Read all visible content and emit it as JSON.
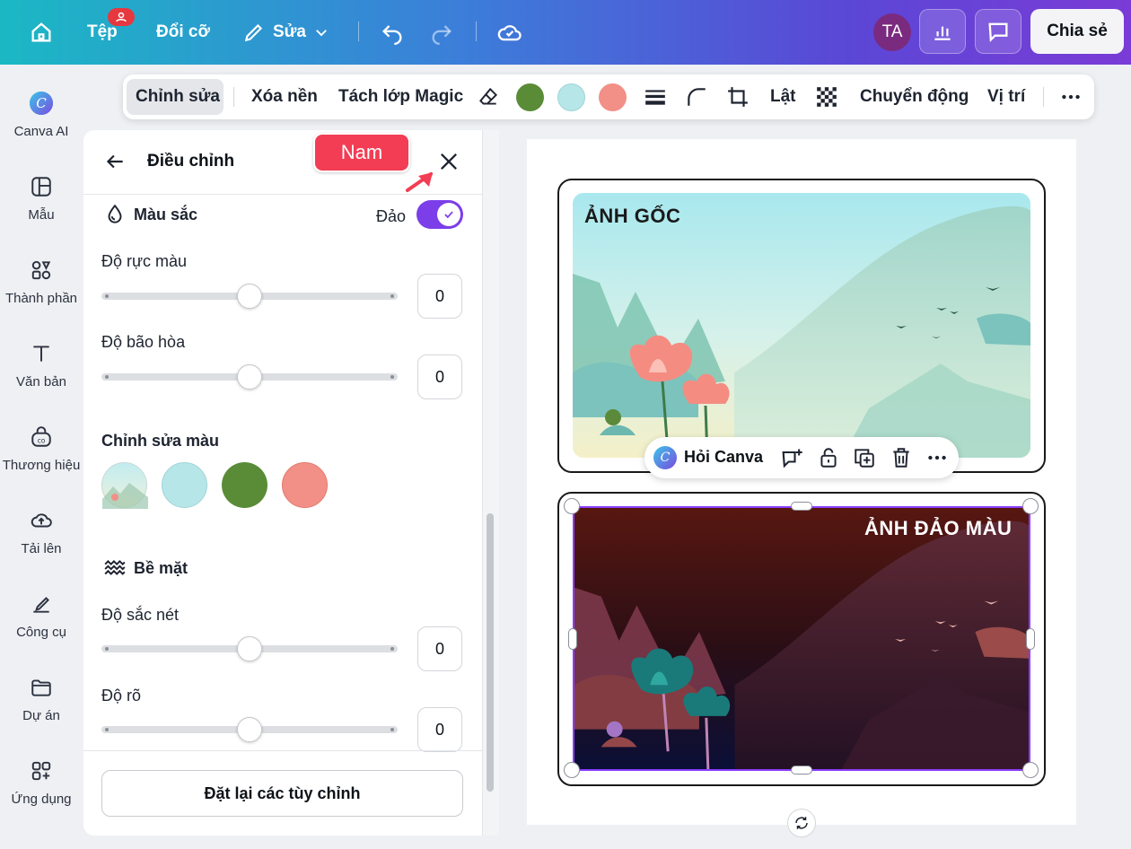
{
  "topbar": {
    "file_label": "Tệp",
    "resize_label": "Đổi cỡ",
    "edit_label": "Sửa",
    "avatar_initials": "TA",
    "share_label": "Chia sẻ"
  },
  "rail": {
    "items": [
      {
        "label": "Canva AI",
        "icon": "canva-ai-icon"
      },
      {
        "label": "Mẫu",
        "icon": "template-icon"
      },
      {
        "label": "Thành phần",
        "icon": "elements-icon"
      },
      {
        "label": "Văn bản",
        "icon": "text-icon"
      },
      {
        "label": "Thương hiệu",
        "icon": "brand-icon"
      },
      {
        "label": "Tải lên",
        "icon": "upload-icon"
      },
      {
        "label": "Công cụ",
        "icon": "tools-icon"
      },
      {
        "label": "Dự án",
        "icon": "folder-icon"
      },
      {
        "label": "Ứng dụng",
        "icon": "apps-icon"
      }
    ]
  },
  "context_toolbar": {
    "edit_label": "Chỉnh sửa",
    "bg_remove_label": "Xóa nền",
    "magic_layer_label": "Tách lớp Magic",
    "flip_label": "Lật",
    "animate_label": "Chuyển động",
    "position_label": "Vị trí",
    "swatch_colors": [
      "#5a8c37",
      "#b7e6e8",
      "#f28f86"
    ]
  },
  "panel": {
    "title": "Điều chỉnh",
    "color_section": "Màu sắc",
    "invert_label": "Đảo",
    "vibrance_label": "Độ rực màu",
    "vibrance_value": "0",
    "saturation_label": "Độ bão hòa",
    "saturation_value": "0",
    "edit_colors_label": "Chỉnh sửa màu",
    "edit_colors": [
      "#b7e6e8",
      "#5a8c37",
      "#f28f86"
    ],
    "surface_section": "Bề mặt",
    "sharpness_label": "Độ sắc nét",
    "sharpness_value": "0",
    "clarity_label": "Độ rõ",
    "clarity_value": "0",
    "reset_label": "Đặt lại các tùy chỉnh"
  },
  "annotation": {
    "badge_text": "Nam"
  },
  "canvas": {
    "original_label": "ẢNH GỐC",
    "inverted_label": "ẢNH ĐẢO MÀU",
    "ask_canva_label": "Hỏi Canva"
  }
}
